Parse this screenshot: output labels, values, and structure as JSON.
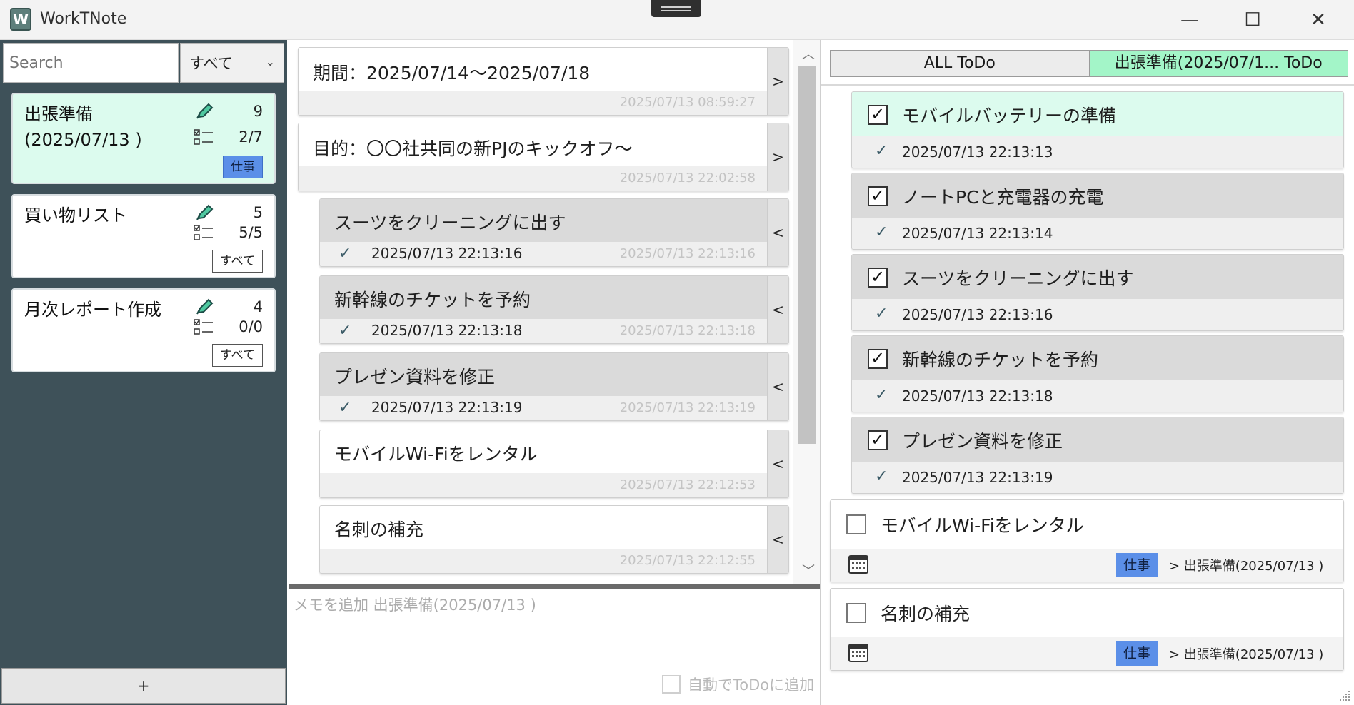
{
  "window": {
    "title": "WorkTNote",
    "app_icon_letter": "W",
    "min_glyph": "—",
    "max_glyph": "☐",
    "close_glyph": "✕"
  },
  "sidebar": {
    "search_placeholder": "Search",
    "filter_value": "すべて",
    "filter_chevron": "⌄",
    "add_label": "+",
    "notes": [
      {
        "title": "出張準備\n(2025/07/13 )",
        "title_line1": "出張準備",
        "title_line2": "(2025/07/13 )",
        "memo_count": "9",
        "todo_count": "2/7",
        "tag": "仕事",
        "selected": true
      },
      {
        "title_line1": "買い物リスト",
        "title_line2": "",
        "memo_count": "5",
        "todo_count": "5/5",
        "tag": "すべて",
        "selected": false
      },
      {
        "title_line1": "月次レポート作成",
        "title_line2": "",
        "memo_count": "4",
        "todo_count": "0/0",
        "tag": "すべて",
        "selected": false
      }
    ]
  },
  "memos": {
    "items": [
      {
        "text": "期間：2025/07/14〜2025/07/18",
        "time": "2025/07/13 08:59:27",
        "arrow": ">"
      },
      {
        "text": "目的：〇〇社共同の新PJのキックオフ〜",
        "time": "2025/07/13 22:02:58",
        "arrow": ">"
      },
      {
        "text": "スーツをクリーニングに出す",
        "done_time": "2025/07/13 22:13:16",
        "time": "2025/07/13 22:13:16",
        "arrow": "<"
      },
      {
        "text": "新幹線のチケットを予約",
        "done_time": "2025/07/13 22:13:18",
        "time": "2025/07/13 22:13:18",
        "arrow": "<"
      },
      {
        "text": "プレゼン資料を修正",
        "done_time": "2025/07/13 22:13:19",
        "time": "2025/07/13 22:13:19",
        "arrow": "<"
      },
      {
        "text": "モバイルWi-Fiをレンタル",
        "time": "2025/07/13 22:12:53",
        "arrow": "<"
      },
      {
        "text": "名刺の補充",
        "time": "2025/07/13 22:12:55",
        "arrow": "<"
      }
    ],
    "check_glyph": "✓",
    "scroll_up": "︿",
    "scroll_down": "﹀",
    "input_placeholder": "メモを追加 出張準備(2025/07/13 )",
    "auto_todo_label": "自動でToDoに追加"
  },
  "todo": {
    "tab_all": "ALL ToDo",
    "tab_note": "出張準備(2025/07/1... ToDo",
    "check_glyph": "✓",
    "box_glyph": "✓",
    "done_items": [
      {
        "text": "モバイルバッテリーの準備",
        "time": "2025/07/13 22:13:13"
      },
      {
        "text": "ノートPCと充電器の充電",
        "time": "2025/07/13 22:13:14"
      },
      {
        "text": "スーツをクリーニングに出す",
        "time": "2025/07/13 22:13:16"
      },
      {
        "text": "新幹線のチケットを予約",
        "time": "2025/07/13 22:13:18"
      },
      {
        "text": "プレゼン資料を修正",
        "time": "2025/07/13 22:13:19"
      }
    ],
    "open_items": [
      {
        "text": "モバイルWi-Fiをレンタル",
        "tag": "仕事",
        "crumb": ">  出張準備(2025/07/13 )"
      },
      {
        "text": "名刺の補充",
        "tag": "仕事",
        "crumb": ">  出張準備(2025/07/13 )"
      }
    ]
  },
  "colors": {
    "sidebar_bg": "#3e5159",
    "selected_note_bg": "#dcfbee",
    "tab_active_bg": "#a3f5c8",
    "tag_work_bg": "#5b8fe8"
  }
}
